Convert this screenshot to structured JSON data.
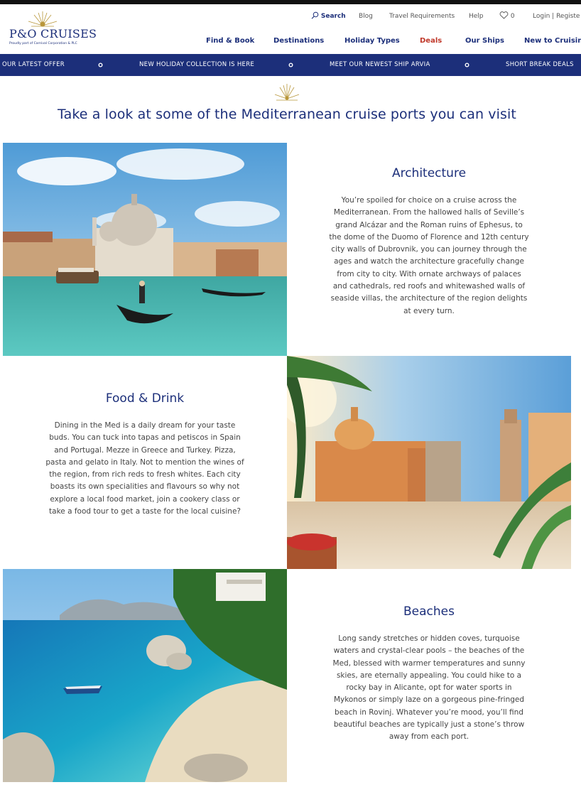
{
  "brand": {
    "name": "P&O CRUISES",
    "tagline": "Proudly part of Carnival Corporation & PLC",
    "color": "#1c2f7a"
  },
  "utility_nav": {
    "search": "Search",
    "blog": "Blog",
    "travel_requirements": "Travel Requirements",
    "help": "Help",
    "favourites_count": "0",
    "login": "Login",
    "separator": "|",
    "register": "Registe"
  },
  "main_nav": {
    "items": [
      "Find & Book",
      "Destinations",
      "Holiday Types",
      "Deals",
      "Our Ships",
      "New to Cruising"
    ],
    "deals_color": "#c0392b"
  },
  "promo_bar": {
    "items": [
      "OUR LATEST OFFER",
      "NEW HOLIDAY COLLECTION IS HERE",
      "MEET OUR NEWEST SHIP ARVIA",
      "SHORT BREAK DEALS"
    ]
  },
  "page": {
    "title": "Take a look at some of the Mediterranean cruise ports you can visit"
  },
  "sections": [
    {
      "heading": "Architecture",
      "body": "You’re spoiled for choice on a cruise across the Mediterranean. From the hallowed halls of Seville’s grand Alcázar and the Roman ruins of Ephesus, to the dome of the Duomo of Florence and 12th century city walls of Dubrovnik, you can journey through the ages and watch the architecture gracefully change from city to city. With ornate archways of palaces and cathedrals, red roofs and whitewashed walls of seaside villas, the architecture of the region delights at every turn."
    },
    {
      "heading": "Food & Drink",
      "body": "Dining in the Med is a daily dream for your taste buds. You can tuck into tapas and petiscos in Spain and Portugal. Mezze in Greece and Turkey. Pizza, pasta and gelato in Italy. Not to mention the wines of the region, from rich reds to fresh whites. Each city boasts its own specialities and flavours so why not explore a local food market, join a cookery class or take a food tour to get a taste for the local cuisine?"
    },
    {
      "heading": "Beaches",
      "body": "Long sandy stretches or hidden coves, turquoise waters and crystal-clear pools – the beaches of the Med, blessed with warmer temperatures and sunny skies, are eternally appealing. You could hike to a rocky bay in Alicante, opt for water sports in Mykonos or simply laze on a gorgeous pine-fringed beach in Rovinj. Whatever you’re mood, you’ll find beautiful beaches are typically just a stone’s throw away from each port."
    }
  ],
  "icons": [
    "sun-logo-icon",
    "search-icon",
    "heart-icon",
    "promo-dot-icon"
  ]
}
